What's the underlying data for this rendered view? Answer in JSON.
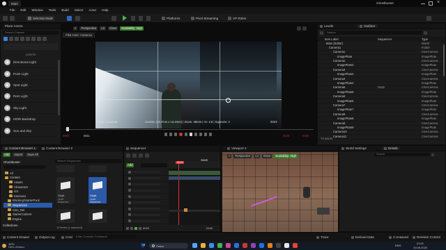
{
  "window": {
    "title": "Ghostbuster",
    "level_tab": "Main"
  },
  "menu": [
    "File",
    "Edit",
    "Window",
    "Tools",
    "Build",
    "Select",
    "Actor",
    "Help"
  ],
  "toolbar": {
    "mode": "Selection Mode",
    "platforms": "Platforms",
    "pixel_streaming": "Pixel Streaming",
    "vp_roles": "VP Roles"
  },
  "place_actors": {
    "title": "Place Actors",
    "search_placeholder": "Search Classes",
    "section": "LIGHTS",
    "items": [
      "Directional Light",
      "Point Light",
      "Spot Light",
      "Rect Light",
      "Sky Light",
      "HDRI Backdrop",
      "Sun and Sky"
    ]
  },
  "viewport_main": {
    "perspective": "Perspective",
    "lit": "Lit",
    "show": "Show",
    "scalability": "Scalability: High",
    "pilot": "Pilot Actor: Camera1",
    "cam_left": "Seq6: Camera6",
    "cam_info": "Custom (15,7mm x 13,4mm) | Zoom: 35mm | Av: 2,8 | Squeeze: 2",
    "frame": "0023",
    "timeline_start": "0000",
    "timeline_range": "0811",
    "timeline_end": "0120",
    "timeline_end2": "0150"
  },
  "levels_panel": {
    "title": "Levels"
  },
  "outliner": {
    "title": "Outliner",
    "search_placeholder": "Search",
    "col_item": "Item Label",
    "col_seq": "Sequencer",
    "col_type": "Type",
    "rows": [
      {
        "label": "Main (Editor)",
        "seq": "",
        "type": "World"
      },
      {
        "label": "Camera1",
        "seq": "",
        "type": "Folder"
      },
      {
        "label": "Camera1",
        "seq": "",
        "type": "CineCamera"
      },
      {
        "label": "ImagePlate",
        "seq": "",
        "type": "ImagePlate"
      },
      {
        "label": "Camera2",
        "seq": "",
        "type": "CineCamera"
      },
      {
        "label": "ImagePlate2",
        "seq": "",
        "type": "ImagePlate"
      },
      {
        "label": "Camera3",
        "seq": "",
        "type": "CineCamera"
      },
      {
        "label": "ImagePlate3",
        "seq": "",
        "type": "ImagePlate"
      },
      {
        "label": "Camera4",
        "seq": "",
        "type": "CineCamera"
      },
      {
        "label": "ImagePlate4",
        "seq": "",
        "type": "ImagePlate"
      },
      {
        "label": "Camera5",
        "seq": "Seq6",
        "type": "CineCamera"
      },
      {
        "label": "ImagePlate5",
        "seq": "",
        "type": "ImagePlate"
      },
      {
        "label": "Camera6",
        "seq": "",
        "type": "CineCamera"
      },
      {
        "label": "ImagePlate6",
        "seq": "",
        "type": "ImagePlate"
      },
      {
        "label": "Camera7",
        "seq": "",
        "type": "CineCamera"
      },
      {
        "label": "ImagePlate7",
        "seq": "",
        "type": "ImagePlate"
      },
      {
        "label": "Camera8",
        "seq": "",
        "type": "CineCamera"
      },
      {
        "label": "ImagePlate8",
        "seq": "",
        "type": "ImagePlate"
      },
      {
        "label": "Camera9",
        "seq": "",
        "type": "CineCamera"
      },
      {
        "label": "ImagePlate9",
        "seq": "",
        "type": "ImagePlate"
      },
      {
        "label": "Camera10",
        "seq": "",
        "type": "CineCamera"
      },
      {
        "label": "Camera11",
        "seq": "",
        "type": "CineCamera"
      }
    ],
    "count": "74 actors"
  },
  "content_browser": {
    "tab1": "Content Browser 1",
    "tab2": "Content Browser 2",
    "add": "Add",
    "import": "Import",
    "save_all": "Save All",
    "root": "Ghostbuster",
    "tree": [
      "All",
      "Content",
      "Assets",
      "Characters",
      "GG",
      "Elements",
      "Blocking/StarterPack",
      "Sequences",
      "Cine_Ref",
      "StarterContent",
      "Engine"
    ],
    "search_placeholder": "Search Sequences",
    "assets": [
      {
        "name": "Seq5",
        "sub": "Level Sequence"
      },
      {
        "name": "Seq6",
        "sub": "Level Sequence"
      },
      {
        "name": "Seq7",
        "sub": ""
      },
      {
        "name": "Seq8",
        "sub": ""
      }
    ],
    "collections": "Collections",
    "items_count": "10 items (1 selected)"
  },
  "sequencer": {
    "title": "Sequencer",
    "add": "Add",
    "seq_name": "Seq6",
    "frame": "0023",
    "end_frame": "0140"
  },
  "viewport2": {
    "title": "Viewport 2",
    "perspective": "Perspective",
    "lit": "Lit",
    "show": "Show",
    "scalability": "Scalability: High"
  },
  "world_settings": {
    "title": "World Settings"
  },
  "details": {
    "title": "Details",
    "search_placeholder": "Search"
  },
  "statusbar": {
    "content_drawer": "Content Drawer",
    "output_log": "Output Log",
    "cmd": "Cmd",
    "cmd_placeholder": "Enter Console Command",
    "trace": "Trace",
    "derived": "Derived Data",
    "unsaved": "3 Unsaved",
    "revision": "Revision Control"
  },
  "taskbar": {
    "weather_temp": "10°C",
    "weather_desc": "Небо облачно",
    "search": "Поиск",
    "lang": "ENG",
    "time": "21:01",
    "date": "10.06.2024"
  }
}
